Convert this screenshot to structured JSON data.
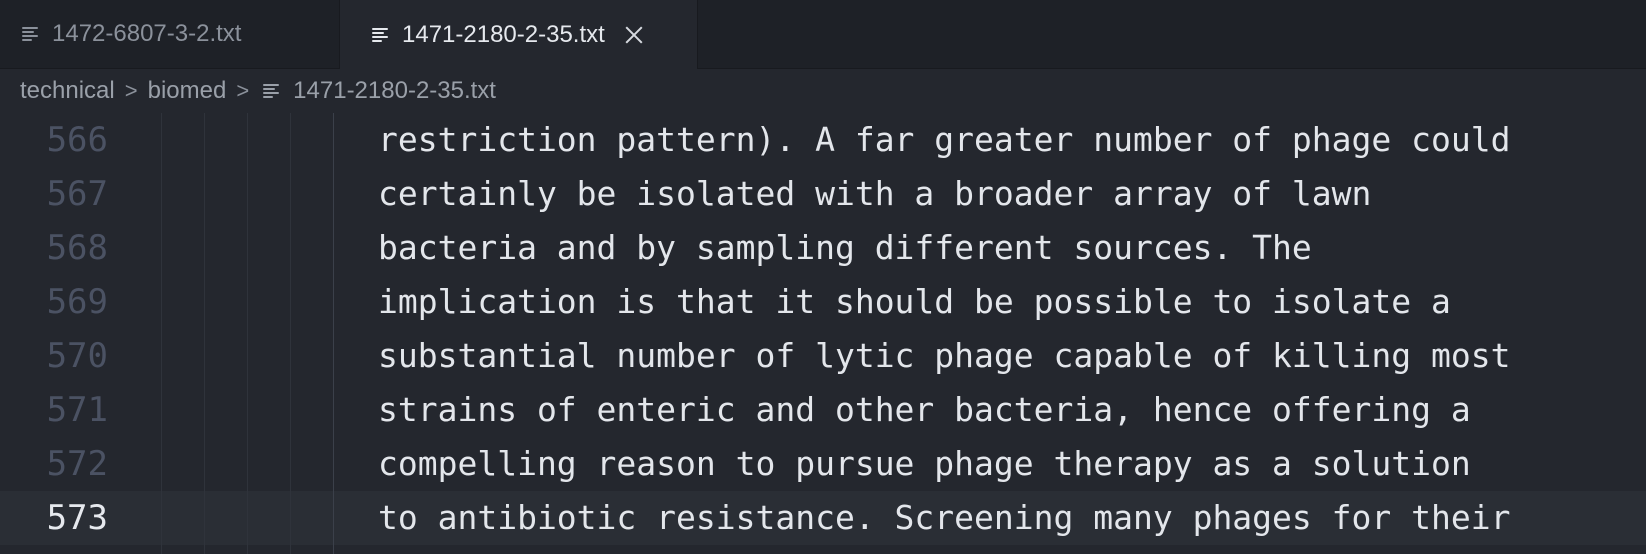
{
  "tabs": [
    {
      "label": "1472-6807-3-2.txt",
      "active": false
    },
    {
      "label": "1471-2180-2-35.txt",
      "active": true
    }
  ],
  "breadcrumb": {
    "items": [
      "technical",
      "biomed"
    ],
    "file": "1471-2180-2-35.txt"
  },
  "editor": {
    "current_line": 573,
    "lines": [
      {
        "number": "566",
        "text": "restriction pattern). A far greater number of phage could"
      },
      {
        "number": "567",
        "text": "certainly be isolated with a broader array of lawn"
      },
      {
        "number": "568",
        "text": "bacteria and by sampling different sources. The"
      },
      {
        "number": "569",
        "text": "implication is that it should be possible to isolate a"
      },
      {
        "number": "570",
        "text": "substantial number of lytic phage capable of killing most"
      },
      {
        "number": "571",
        "text": "strains of enteric and other bacteria, hence offering a"
      },
      {
        "number": "572",
        "text": "compelling reason to pursue phage therapy as a solution"
      },
      {
        "number": "573",
        "text": "to antibiotic resistance. Screening many phages for their"
      }
    ]
  },
  "colors": {
    "background": "#24272e",
    "tabbar": "#1e2127",
    "text": "#e3e6eb",
    "line_number": "#4b5263"
  }
}
